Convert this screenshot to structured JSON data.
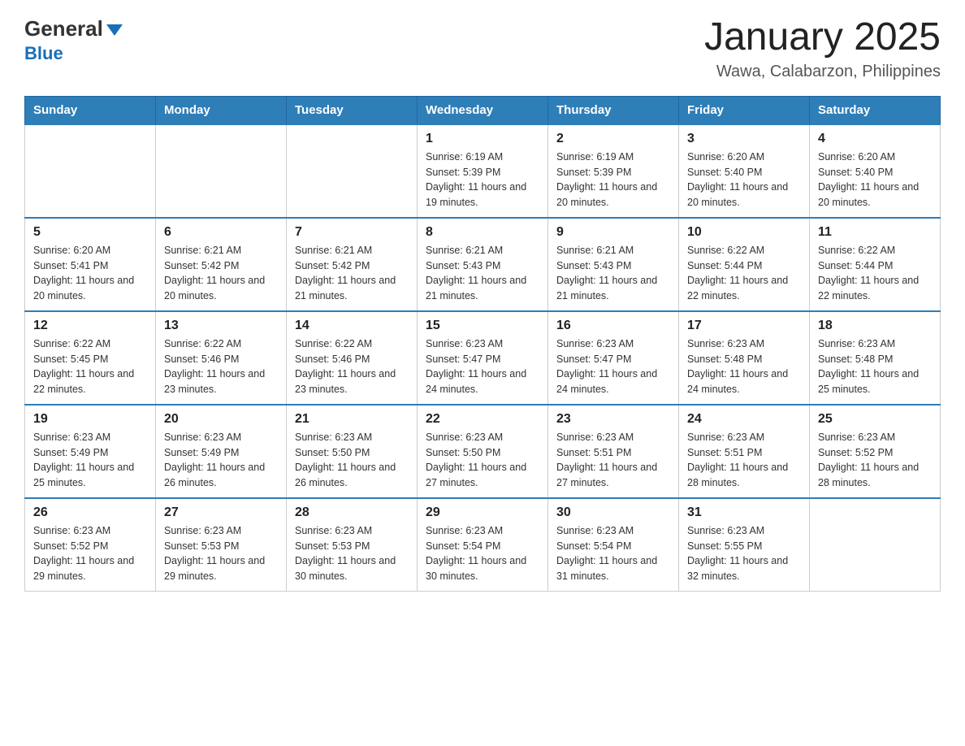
{
  "header": {
    "logo_general": "General",
    "logo_blue": "Blue",
    "main_title": "January 2025",
    "subtitle": "Wawa, Calabarzon, Philippines"
  },
  "days_of_week": [
    "Sunday",
    "Monday",
    "Tuesday",
    "Wednesday",
    "Thursday",
    "Friday",
    "Saturday"
  ],
  "weeks": [
    [
      {
        "day": "",
        "info": ""
      },
      {
        "day": "",
        "info": ""
      },
      {
        "day": "",
        "info": ""
      },
      {
        "day": "1",
        "info": "Sunrise: 6:19 AM\nSunset: 5:39 PM\nDaylight: 11 hours and 19 minutes."
      },
      {
        "day": "2",
        "info": "Sunrise: 6:19 AM\nSunset: 5:39 PM\nDaylight: 11 hours and 20 minutes."
      },
      {
        "day": "3",
        "info": "Sunrise: 6:20 AM\nSunset: 5:40 PM\nDaylight: 11 hours and 20 minutes."
      },
      {
        "day": "4",
        "info": "Sunrise: 6:20 AM\nSunset: 5:40 PM\nDaylight: 11 hours and 20 minutes."
      }
    ],
    [
      {
        "day": "5",
        "info": "Sunrise: 6:20 AM\nSunset: 5:41 PM\nDaylight: 11 hours and 20 minutes."
      },
      {
        "day": "6",
        "info": "Sunrise: 6:21 AM\nSunset: 5:42 PM\nDaylight: 11 hours and 20 minutes."
      },
      {
        "day": "7",
        "info": "Sunrise: 6:21 AM\nSunset: 5:42 PM\nDaylight: 11 hours and 21 minutes."
      },
      {
        "day": "8",
        "info": "Sunrise: 6:21 AM\nSunset: 5:43 PM\nDaylight: 11 hours and 21 minutes."
      },
      {
        "day": "9",
        "info": "Sunrise: 6:21 AM\nSunset: 5:43 PM\nDaylight: 11 hours and 21 minutes."
      },
      {
        "day": "10",
        "info": "Sunrise: 6:22 AM\nSunset: 5:44 PM\nDaylight: 11 hours and 22 minutes."
      },
      {
        "day": "11",
        "info": "Sunrise: 6:22 AM\nSunset: 5:44 PM\nDaylight: 11 hours and 22 minutes."
      }
    ],
    [
      {
        "day": "12",
        "info": "Sunrise: 6:22 AM\nSunset: 5:45 PM\nDaylight: 11 hours and 22 minutes."
      },
      {
        "day": "13",
        "info": "Sunrise: 6:22 AM\nSunset: 5:46 PM\nDaylight: 11 hours and 23 minutes."
      },
      {
        "day": "14",
        "info": "Sunrise: 6:22 AM\nSunset: 5:46 PM\nDaylight: 11 hours and 23 minutes."
      },
      {
        "day": "15",
        "info": "Sunrise: 6:23 AM\nSunset: 5:47 PM\nDaylight: 11 hours and 24 minutes."
      },
      {
        "day": "16",
        "info": "Sunrise: 6:23 AM\nSunset: 5:47 PM\nDaylight: 11 hours and 24 minutes."
      },
      {
        "day": "17",
        "info": "Sunrise: 6:23 AM\nSunset: 5:48 PM\nDaylight: 11 hours and 24 minutes."
      },
      {
        "day": "18",
        "info": "Sunrise: 6:23 AM\nSunset: 5:48 PM\nDaylight: 11 hours and 25 minutes."
      }
    ],
    [
      {
        "day": "19",
        "info": "Sunrise: 6:23 AM\nSunset: 5:49 PM\nDaylight: 11 hours and 25 minutes."
      },
      {
        "day": "20",
        "info": "Sunrise: 6:23 AM\nSunset: 5:49 PM\nDaylight: 11 hours and 26 minutes."
      },
      {
        "day": "21",
        "info": "Sunrise: 6:23 AM\nSunset: 5:50 PM\nDaylight: 11 hours and 26 minutes."
      },
      {
        "day": "22",
        "info": "Sunrise: 6:23 AM\nSunset: 5:50 PM\nDaylight: 11 hours and 27 minutes."
      },
      {
        "day": "23",
        "info": "Sunrise: 6:23 AM\nSunset: 5:51 PM\nDaylight: 11 hours and 27 minutes."
      },
      {
        "day": "24",
        "info": "Sunrise: 6:23 AM\nSunset: 5:51 PM\nDaylight: 11 hours and 28 minutes."
      },
      {
        "day": "25",
        "info": "Sunrise: 6:23 AM\nSunset: 5:52 PM\nDaylight: 11 hours and 28 minutes."
      }
    ],
    [
      {
        "day": "26",
        "info": "Sunrise: 6:23 AM\nSunset: 5:52 PM\nDaylight: 11 hours and 29 minutes."
      },
      {
        "day": "27",
        "info": "Sunrise: 6:23 AM\nSunset: 5:53 PM\nDaylight: 11 hours and 29 minutes."
      },
      {
        "day": "28",
        "info": "Sunrise: 6:23 AM\nSunset: 5:53 PM\nDaylight: 11 hours and 30 minutes."
      },
      {
        "day": "29",
        "info": "Sunrise: 6:23 AM\nSunset: 5:54 PM\nDaylight: 11 hours and 30 minutes."
      },
      {
        "day": "30",
        "info": "Sunrise: 6:23 AM\nSunset: 5:54 PM\nDaylight: 11 hours and 31 minutes."
      },
      {
        "day": "31",
        "info": "Sunrise: 6:23 AM\nSunset: 5:55 PM\nDaylight: 11 hours and 32 minutes."
      },
      {
        "day": "",
        "info": ""
      }
    ]
  ]
}
